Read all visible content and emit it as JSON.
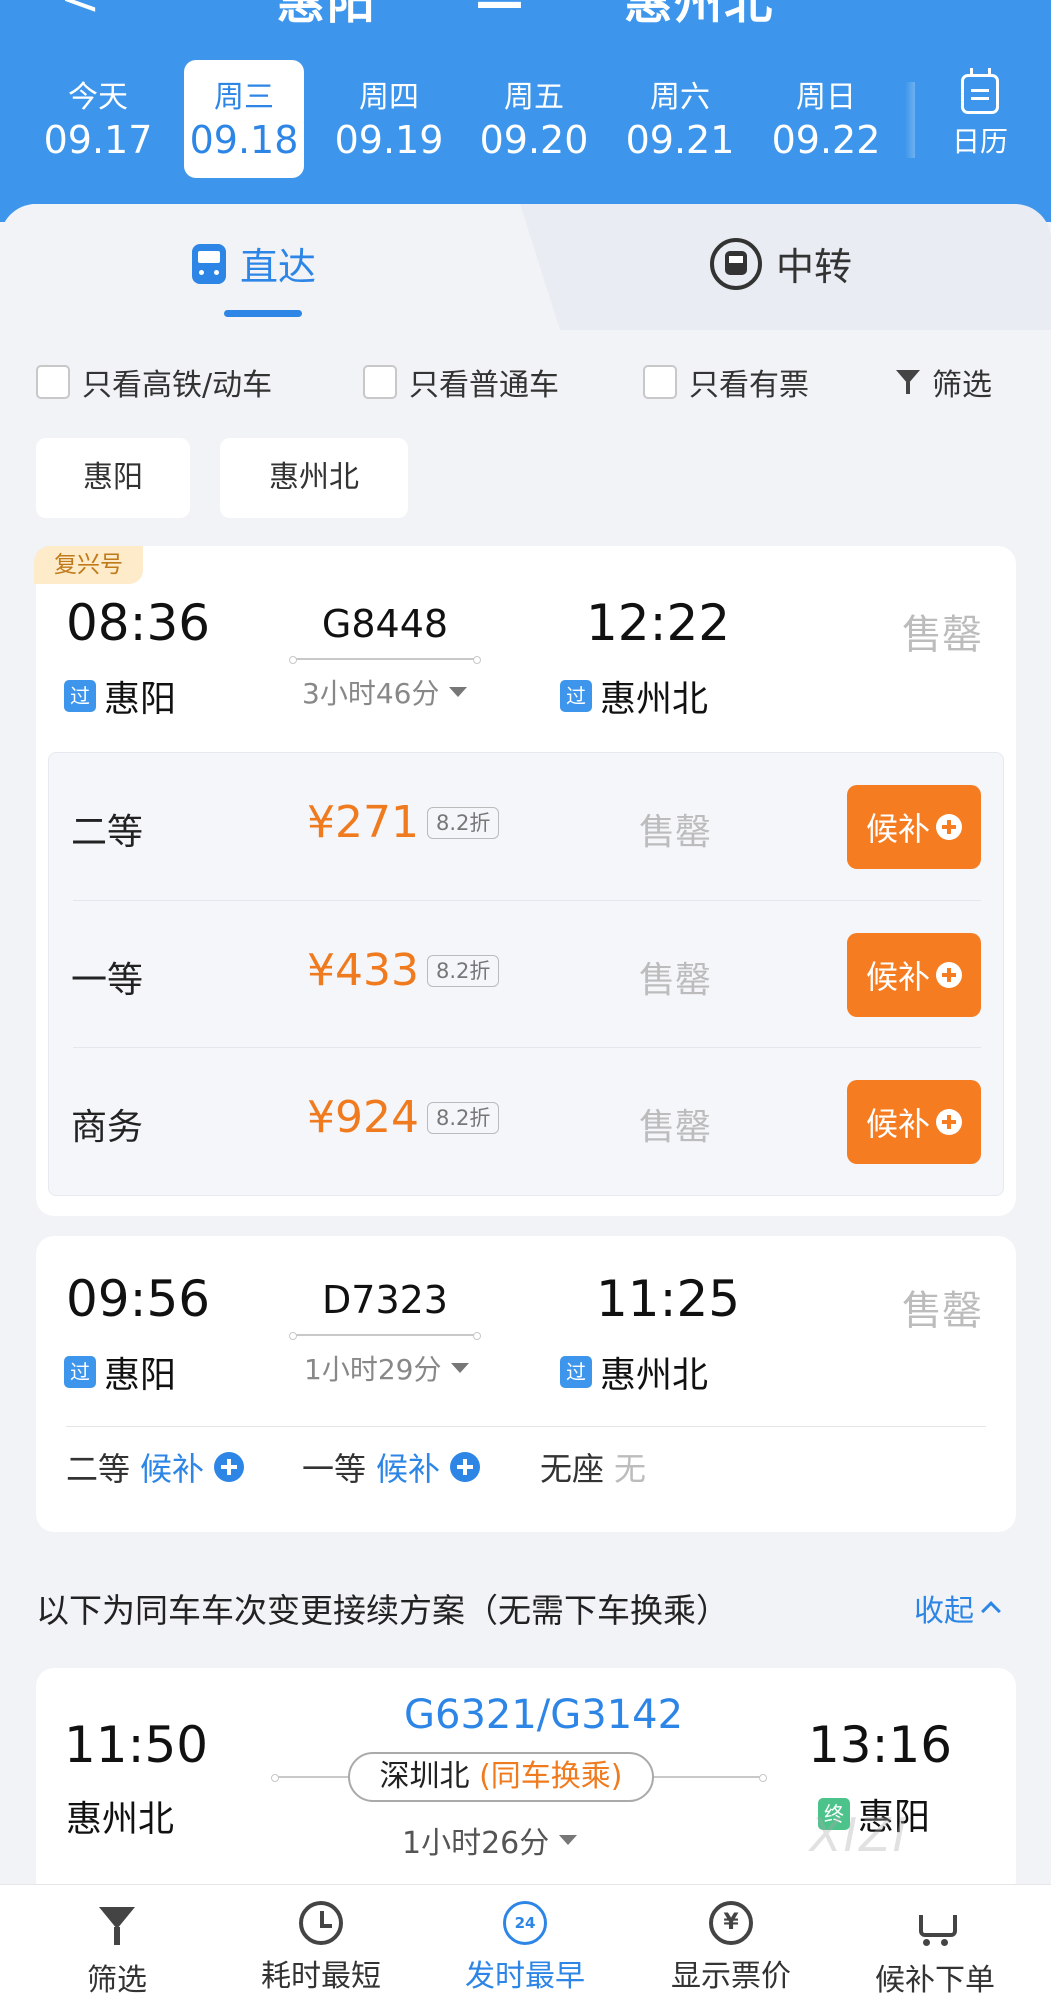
{
  "header": {
    "origin": "惠阳",
    "destination": "惠州北",
    "back_label": "<",
    "dates": [
      {
        "weekday": "今天",
        "date": "09.17"
      },
      {
        "weekday": "周三",
        "date": "09.18"
      },
      {
        "weekday": "周四",
        "date": "09.19"
      },
      {
        "weekday": "周五",
        "date": "09.20"
      },
      {
        "weekday": "周六",
        "date": "09.21"
      },
      {
        "weekday": "周日",
        "date": "09.22"
      }
    ],
    "selected_date_index": 1,
    "calendar_label": "日历"
  },
  "mode_tabs": {
    "direct": "直达",
    "transfer": "中转",
    "active": "direct"
  },
  "filters": {
    "high_speed_only": "只看高铁/动车",
    "normal_only": "只看普通车",
    "available_only": "只看有票",
    "filter_label": "筛选"
  },
  "station_chips": [
    "惠阳",
    "惠州北"
  ],
  "trains": [
    {
      "badge": "复兴号",
      "depart_time": "08:36",
      "depart_station": "惠阳",
      "depart_tag": "过",
      "train_no": "G8448",
      "duration": "3小时46分",
      "arrive_time": "12:22",
      "arrive_station": "惠州北",
      "arrive_tag": "过",
      "status": "售罄",
      "seats": [
        {
          "name": "二等",
          "price": "¥271",
          "discount": "8.2折",
          "status": "售罄",
          "action": "候补"
        },
        {
          "name": "一等",
          "price": "¥433",
          "discount": "8.2折",
          "status": "售罄",
          "action": "候补"
        },
        {
          "name": "商务",
          "price": "¥924",
          "discount": "8.2折",
          "status": "售罄",
          "action": "候补"
        }
      ]
    },
    {
      "depart_time": "09:56",
      "depart_station": "惠阳",
      "depart_tag": "过",
      "train_no": "D7323",
      "duration": "1小时29分",
      "arrive_time": "11:25",
      "arrive_station": "惠州北",
      "arrive_tag": "过",
      "status": "售罄",
      "seat_summary": [
        {
          "name": "二等",
          "value": "候补"
        },
        {
          "name": "一等",
          "value": "候补"
        },
        {
          "name": "无座",
          "value": "无"
        }
      ]
    }
  ],
  "same_train_section": {
    "title": "以下为同车车次变更接续方案（无需下车换乘）",
    "collapse_label": "收起"
  },
  "connection": {
    "depart_time": "11:50",
    "depart_station": "惠州北",
    "train_nos": "G6321/G3142",
    "transfer_station": "深圳北",
    "transfer_note": "(同车换乘)",
    "duration": "1小时26分",
    "arrive_time": "13:16",
    "arrive_station": "惠阳",
    "arrive_tag": "终"
  },
  "watermark": "XIZI",
  "bottom_nav": [
    {
      "label": "筛选",
      "icon": "filter-icon"
    },
    {
      "label": "耗时最短",
      "icon": "clock-icon"
    },
    {
      "label": "发时最早",
      "icon": "24h-icon",
      "icon_text": "24",
      "active": true
    },
    {
      "label": "显示票价",
      "icon": "yen-icon",
      "icon_text": "¥"
    },
    {
      "label": "候补下单",
      "icon": "cart-icon"
    }
  ],
  "colors": {
    "primary_blue": "#3d96ec",
    "accent_blue": "#2d86e6",
    "orange": "#f57c21",
    "price_orange": "#f07b1f",
    "soldout_grey": "#bcbcbc"
  }
}
